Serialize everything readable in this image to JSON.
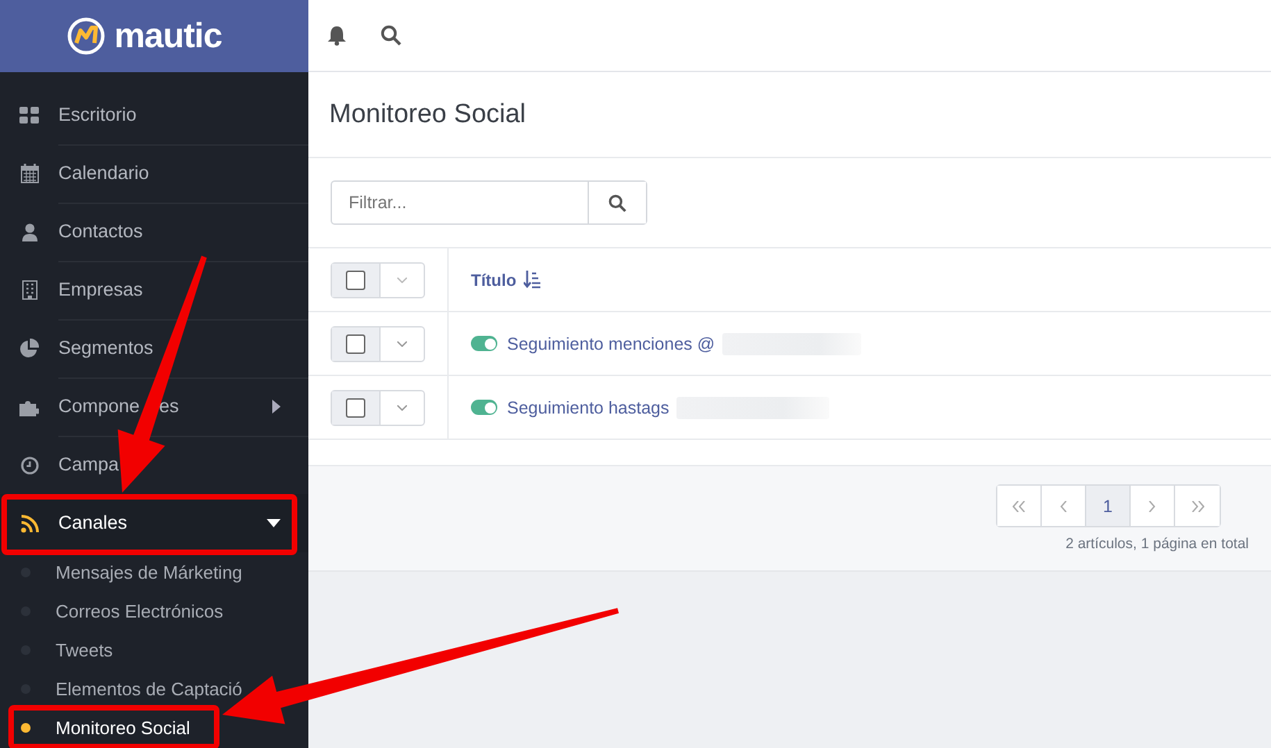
{
  "brand": {
    "name": "mautic"
  },
  "sidebar": {
    "items": [
      {
        "label": "Escritorio",
        "active": false
      },
      {
        "label": "Calendario",
        "active": false
      },
      {
        "label": "Contactos",
        "active": false
      },
      {
        "label": "Empresas",
        "active": false
      },
      {
        "label": "Segmentos",
        "active": false
      },
      {
        "label": "Compone",
        "label_rest": "es",
        "active": false,
        "expanded": false
      },
      {
        "label": "Campa",
        "active": false
      },
      {
        "label": "Canales",
        "active": true,
        "expanded": true,
        "children": [
          {
            "label": "Mensajes de Márketing",
            "selected": false
          },
          {
            "label": "Correos Electrónicos",
            "selected": false
          },
          {
            "label": "Tweets",
            "selected": false
          },
          {
            "label": "Elementos de Captació",
            "selected": false
          },
          {
            "label": "Monitoreo Social",
            "selected": true
          }
        ]
      }
    ]
  },
  "page": {
    "title": "Monitoreo Social"
  },
  "filter": {
    "placeholder": "Filtrar..."
  },
  "table": {
    "columns": [
      "Título"
    ],
    "header_checked": false,
    "rows": [
      {
        "title": "Seguimiento menciones @",
        "on": true,
        "checked": false
      },
      {
        "title": "Seguimiento hastags",
        "on": true,
        "checked": false
      }
    ]
  },
  "pagination": {
    "pages": [
      {
        "label": "1",
        "selected": true
      }
    ],
    "summary": "2 artículos, 1 página en total"
  },
  "annotations": [
    {
      "kind": "arrow"
    },
    {
      "kind": "arrow"
    },
    {
      "kind": "highlight"
    },
    {
      "kind": "highlight"
    }
  ]
}
